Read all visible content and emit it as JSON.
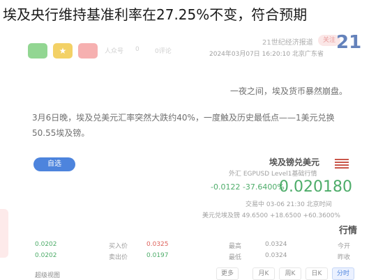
{
  "headline": "埃及央行维持基准利率在27.25%不变，符合预期",
  "toolbar": {
    "icon_labels": [
      "",
      "",
      ""
    ],
    "texts": [
      "人众号",
      "0",
      "0评论"
    ]
  },
  "header": {
    "brand": "21世纪经济报道",
    "follow_label": "关注",
    "meta": "2024年03月07日 16:20:10 北京广东省",
    "logo": "21"
  },
  "article": {
    "p1": "一夜之间，埃及货币暴然崩盘。",
    "p2a": "3月6日晚，埃及兑美元汇率突然大跌约40%，一度触及历史最低点——1美元兑换",
    "p2b": "50.55埃及镑。"
  },
  "quote": {
    "title": "埃及镑兑美元",
    "code_line": "外汇  EGPUSD  Level1基础行情",
    "price": "0.020180",
    "change": "-0.0122  -37.6400%",
    "time": "交易中 03-06 21:30 北京时间",
    "related": "美元兑埃及镑 49.6500 +18.6500 +60.3600%",
    "button_label": "自选"
  },
  "market": {
    "title": "行情",
    "rows": [
      [
        "今开",
        "0.0324",
        "最高",
        "0.0325",
        "买入价",
        "0.0202"
      ],
      [
        "昨收",
        "0.0324",
        "最低",
        "0.0197",
        "卖出价",
        "0.0202"
      ]
    ]
  },
  "tabs": {
    "items": [
      "分时",
      "日K",
      "周K",
      "月K",
      "更多"
    ],
    "active_index": 0,
    "extra": "超级视图"
  },
  "colors": {
    "down": "#2e9e4f",
    "accent": "#2e6fd8",
    "headline_text": "#1a1a1a"
  }
}
